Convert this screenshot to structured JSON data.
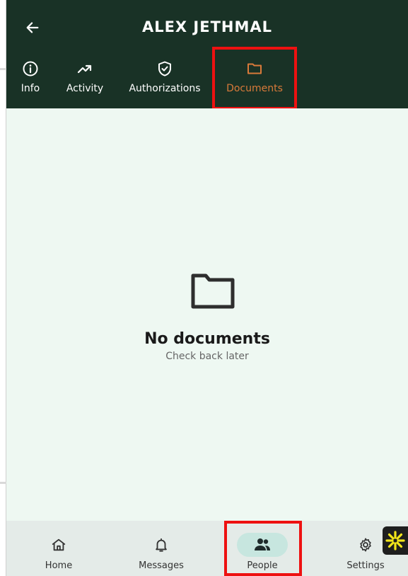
{
  "header": {
    "title": "ALEX JETHMAL",
    "back_icon": "arrow-left-icon",
    "background_color": "#193226"
  },
  "tabs": [
    {
      "label": "Info",
      "icon": "info-circle-icon",
      "active": false
    },
    {
      "label": "Activity",
      "icon": "trending-up-icon",
      "active": false
    },
    {
      "label": "Authorizations",
      "icon": "shield-check-icon",
      "active": false
    },
    {
      "label": "Documents",
      "icon": "folder-icon",
      "active": true
    }
  ],
  "empty_state": {
    "icon": "folder-icon",
    "title": "No documents",
    "subtitle": "Check back later"
  },
  "bottom_nav": [
    {
      "label": "Home",
      "icon": "home-icon",
      "active": false
    },
    {
      "label": "Messages",
      "icon": "bell-icon",
      "active": false
    },
    {
      "label": "People",
      "icon": "people-icon",
      "active": true
    },
    {
      "label": "Settings",
      "icon": "gear-icon",
      "active": false
    }
  ],
  "colors": {
    "accent": "#d97a3a",
    "highlight": "#ee1111",
    "content_background": "#eef8f2",
    "nav_background": "#e4ebe8",
    "active_pill": "#c7e6df",
    "fab_spark": "#f2e51a"
  }
}
